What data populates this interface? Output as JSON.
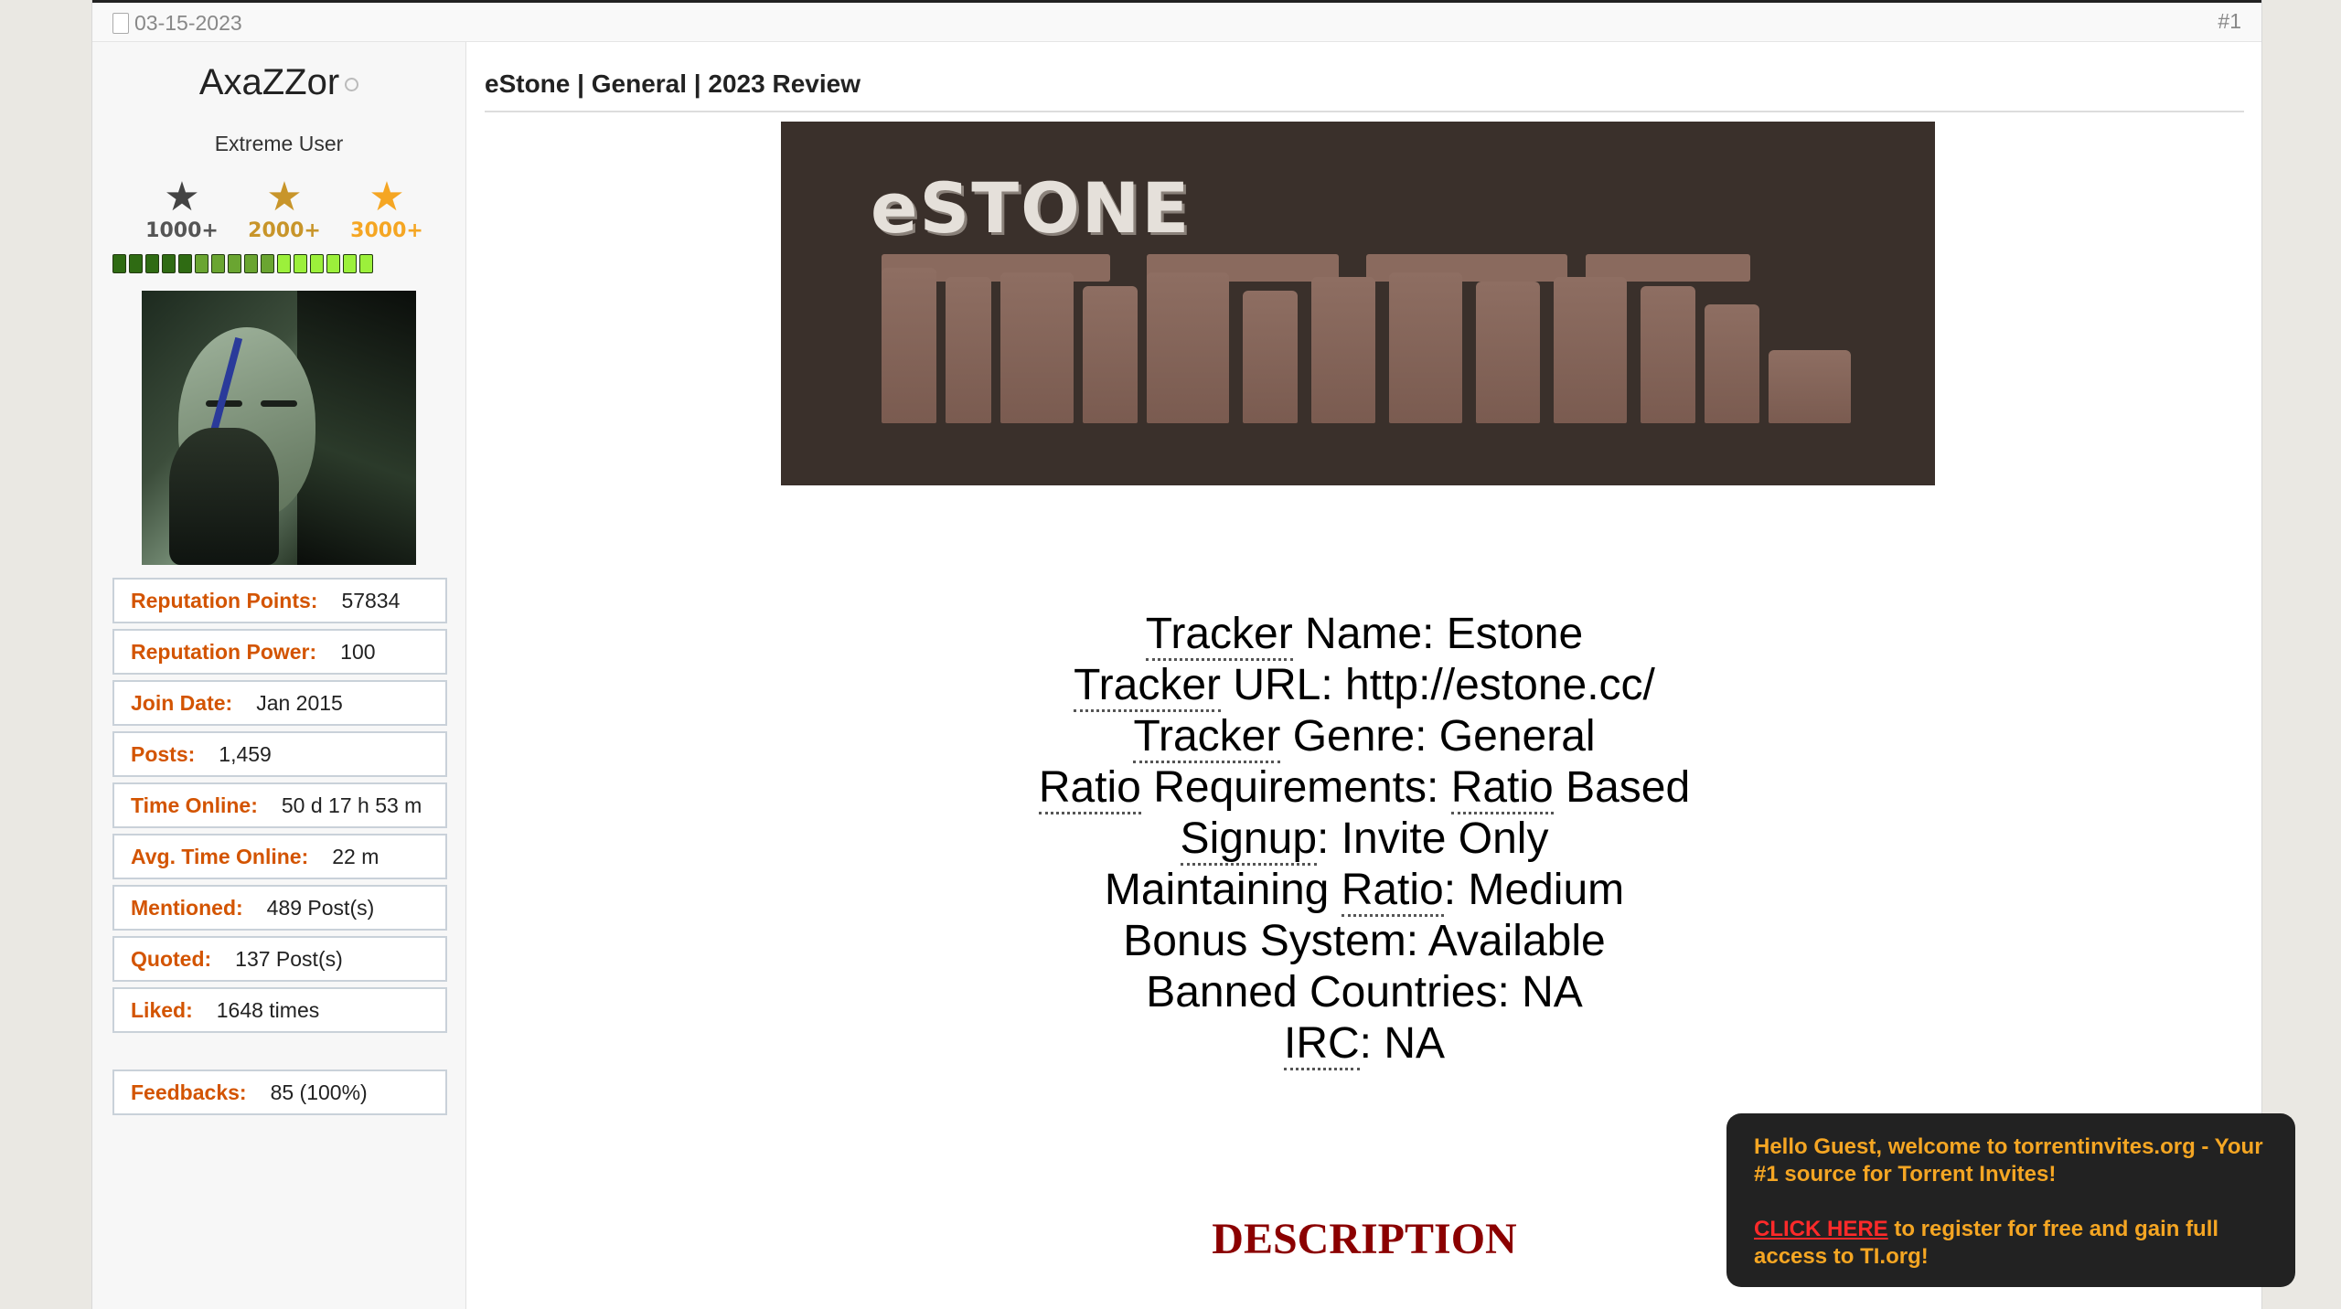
{
  "post": {
    "date": "03-15-2023",
    "number": "#1",
    "title": "eStone | General | 2023 Review"
  },
  "user": {
    "name": "AxaZZor",
    "title": "Extreme User",
    "awards": [
      {
        "label": "1000+",
        "color": "#3b3b3b"
      },
      {
        "label": "2000+",
        "color": "#b8860b"
      },
      {
        "label": "3000+",
        "color": "#f5a623"
      }
    ],
    "reputation_segments": {
      "dark": 5,
      "mid": 5,
      "light": 6,
      "colors": {
        "dark": "#2f6b13",
        "mid": "#6aa531",
        "light": "#9cf03b"
      }
    },
    "stats": [
      {
        "key": "Reputation Points:",
        "value": "57834"
      },
      {
        "key": "Reputation Power:",
        "value": "100"
      },
      {
        "key": "Join Date:",
        "value": "Jan 2015"
      },
      {
        "key": "Posts:",
        "value": "1,459"
      },
      {
        "key": "Time Online:",
        "value": "50 d 17 h 53 m"
      },
      {
        "key": "Avg. Time Online:",
        "value": "22 m"
      },
      {
        "key": "Mentioned:",
        "value": "489 Post(s)"
      },
      {
        "key": "Quoted:",
        "value": "137 Post(s)"
      },
      {
        "key": "Liked:",
        "value": "1648 times"
      }
    ],
    "feedback": {
      "key": "Feedbacks:",
      "value": "85 (100%)"
    }
  },
  "banner": {
    "logo_text": "eSTONE"
  },
  "tracker": {
    "name_label_u": "Tracker",
    "name_label_rest": " Name: ",
    "name_value": "Estone",
    "url_label_u": "Tracker",
    "url_label_rest": " URL: ",
    "url_value": "http://estone.cc/",
    "genre_label_u": "Tracker",
    "genre_label_rest": " Genre: ",
    "genre_value": "General",
    "ratio_req_u": "Ratio",
    "ratio_req_rest": " Requirements: ",
    "ratio_req_value_u": "Ratio",
    "ratio_req_value_rest": " Based",
    "signup_u": "Signup",
    "signup_rest": ": ",
    "signup_value": "Invite Only",
    "maint_label": "Maintaining ",
    "maint_u": "Ratio",
    "maint_rest": ": ",
    "maint_value": "Medium",
    "bonus_label": "Bonus System: ",
    "bonus_value": "Available",
    "banned_label": "Banned Countries: ",
    "banned_value": "NA",
    "irc_u": "IRC",
    "irc_rest": ": ",
    "irc_value": "NA"
  },
  "description_heading": "DESCRIPTION",
  "guest_popup": {
    "line1": "Hello Guest, welcome to torrentinvites.org - Your #1 source for Torrent Invites!",
    "link": "CLICK HERE",
    "line2": " to register for free and gain full access to TI.org!"
  }
}
